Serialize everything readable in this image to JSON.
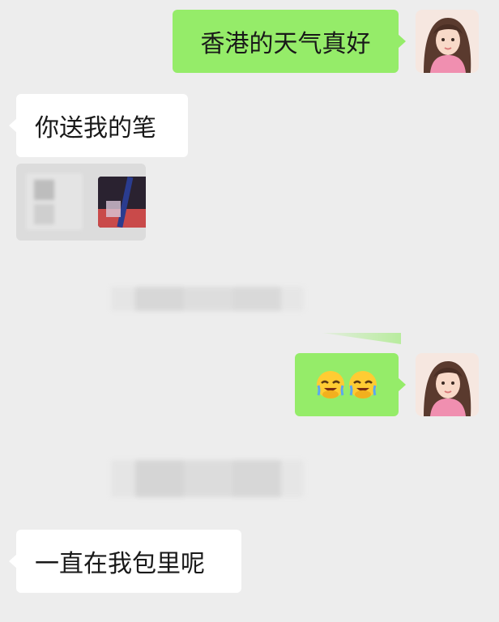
{
  "messages": {
    "m1": {
      "text": "香港的天气真好",
      "direction": "outgoing"
    },
    "m2": {
      "text": "你送我的笔",
      "direction": "incoming"
    },
    "m4": {
      "emojis": [
        "🤦",
        "🤦"
      ],
      "emoji_icon": "face-palm-icon",
      "direction": "outgoing"
    },
    "m6": {
      "text": "一直在我包里呢",
      "direction": "incoming"
    }
  },
  "colors": {
    "background": "#ededed",
    "outgoing_bubble": "#95ec69",
    "incoming_bubble": "#ffffff"
  }
}
